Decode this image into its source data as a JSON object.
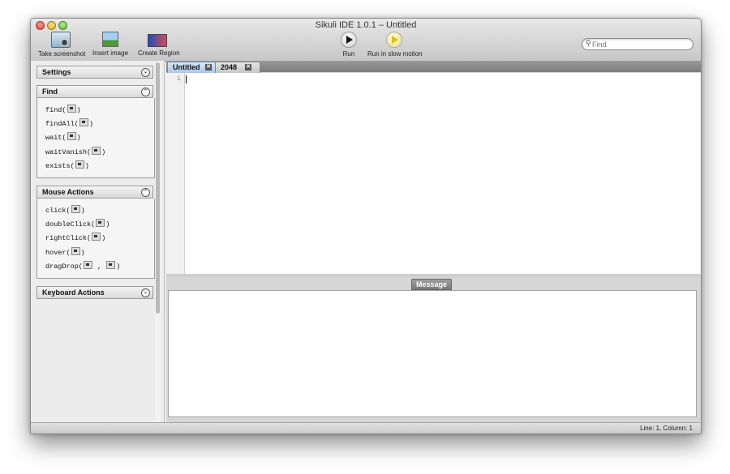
{
  "window": {
    "title": "Sikuli IDE 1.0.1 – Untitled"
  },
  "toolbar": {
    "take_screenshot": "Take screenshot",
    "insert_image": "Insert image",
    "create_region": "Create Region",
    "run": "Run",
    "run_slow": "Run in slow motion"
  },
  "search": {
    "placeholder": "Find"
  },
  "sidebar": {
    "settings": "Settings",
    "find": {
      "title": "Find",
      "items": [
        "find(",
        "findAll(",
        "wait(",
        "waitVanish(",
        "exists("
      ]
    },
    "mouse": {
      "title": "Mouse Actions",
      "items": [
        "click(",
        "doubleClick(",
        "rightClick(",
        "hover(",
        "dragDrop("
      ]
    },
    "keyboard": "Keyboard Actions"
  },
  "tabs": [
    "Untitled",
    "2048"
  ],
  "editor": {
    "line_number": "1"
  },
  "message_tab": "Message",
  "status": "Line: 1, Column: 1"
}
